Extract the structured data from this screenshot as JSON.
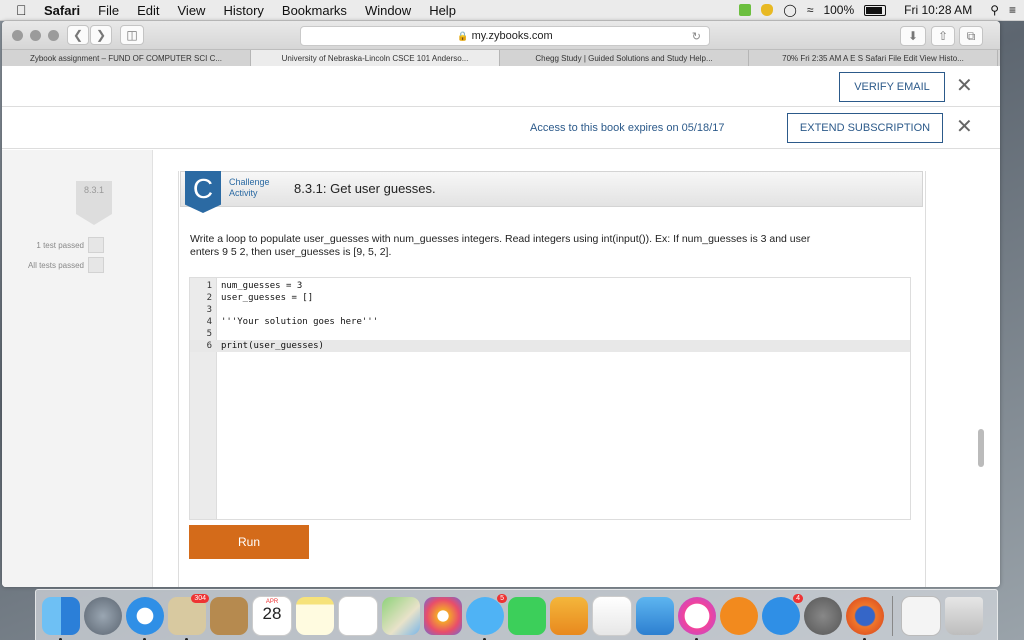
{
  "menubar": {
    "items": [
      "Safari",
      "File",
      "Edit",
      "View",
      "History",
      "Bookmarks",
      "Window",
      "Help"
    ],
    "battery": "100%",
    "clock": "Fri 10:28 AM",
    "icons": [
      "apple-icon",
      "evernote-icon",
      "shield-icon",
      "time-machine-icon",
      "wifi-icon",
      "battery-icon",
      "spotlight-icon",
      "list-icon"
    ]
  },
  "browser": {
    "url": "my.zybooks.com",
    "tabs": [
      "Zybook assignment – FUND OF COMPUTER SCI C...",
      "University of Nebraska-Lincoln CSCE 101 Anderso...",
      "Chegg Study | Guided Solutions and Study Help...",
      "70% Fri 2:35 AM A E S Safari File Edit View Histo..."
    ],
    "active_tab": 1
  },
  "banners": {
    "verify_email": "VERIFY EMAIL",
    "expires_text": "Access to this book expires on 05/18/17",
    "extend_subscription": "EXTEND SUBSCRIPTION",
    "close": "✕"
  },
  "sidebar": {
    "section_badge": "8.3.1",
    "test_passed": "1 test passed",
    "all_tests_passed": "All tests passed"
  },
  "activity": {
    "icon_letter": "C",
    "type_line1": "Challenge",
    "type_line2": "Activity",
    "title": "8.3.1: Get user guesses.",
    "instructions_line1": "Write a loop to populate user_guesses with num_guesses integers. Read integers using int(input()). Ex: If num_guesses is 3 and user",
    "instructions_line2": "enters 9 5 2, then user_guesses is [9, 5, 2].",
    "code_lines": [
      {
        "n": "1",
        "text": "num_guesses = 3"
      },
      {
        "n": "2",
        "text": "user_guesses = []"
      },
      {
        "n": "3",
        "text": ""
      },
      {
        "n": "4",
        "text": "'''Your solution goes here'''"
      },
      {
        "n": "5",
        "text": ""
      },
      {
        "n": "6",
        "text": "print(user_guesses)"
      }
    ],
    "run_label": "Run"
  },
  "dock": {
    "icons": [
      "finder-icon",
      "launchpad-icon",
      "safari-icon",
      "mail-icon",
      "contacts-icon",
      "calendar-icon",
      "notes-icon",
      "reminders-icon",
      "maps-icon",
      "photos-icon",
      "messages-icon",
      "facetime-icon",
      "pages-icon",
      "numbers-icon",
      "keynote-icon",
      "itunes-icon",
      "ibooks-icon",
      "app-store-icon",
      "system-preferences-icon",
      "firefox-icon",
      "documents-icon",
      "trash-icon"
    ],
    "mail_badge": "304",
    "calendar_month": "APR",
    "calendar_day": "28",
    "messages_badge": "5",
    "app_store_badge": "4"
  }
}
